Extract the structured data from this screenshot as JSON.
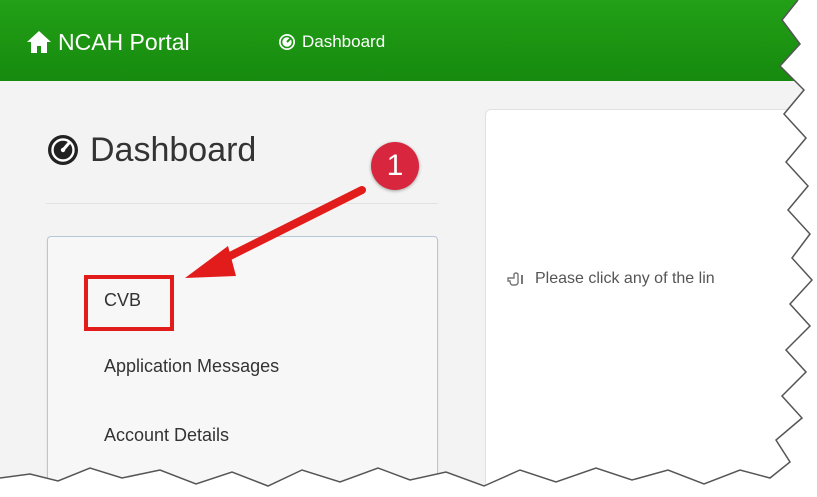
{
  "navbar": {
    "brand_label": "NCAH Portal",
    "brand_icon": "home-icon",
    "dashboard_link_label": "Dashboard",
    "dashboard_icon": "dashboard-gauge-icon",
    "background_color": "#1c9613"
  },
  "page": {
    "title": "Dashboard",
    "title_icon": "dashboard-gauge-icon"
  },
  "sidebar": {
    "items": [
      {
        "label": "CVB"
      },
      {
        "label": "Application Messages"
      },
      {
        "label": "Account Details"
      }
    ]
  },
  "main": {
    "info_text": "Please click any of the lin",
    "info_icon": "hand-pointer-left-icon"
  },
  "annotation": {
    "badge_number": "1",
    "accent_color": "#e21b1b"
  }
}
